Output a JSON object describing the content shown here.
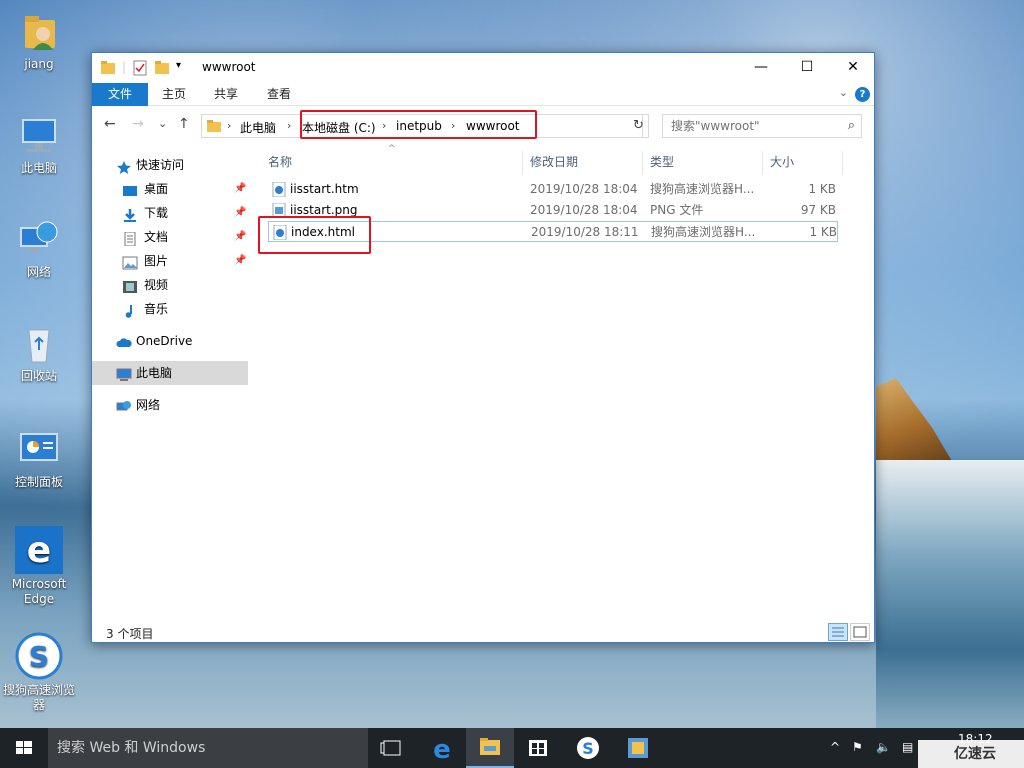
{
  "desktop": {
    "icons": [
      {
        "label": "jiang"
      },
      {
        "label": "此电脑"
      },
      {
        "label": "网络"
      },
      {
        "label": "回收站"
      },
      {
        "label": "控制面板"
      },
      {
        "label": "Microsoft Edge"
      },
      {
        "label": "搜狗高速浏览器"
      }
    ]
  },
  "window": {
    "title": "wwwroot",
    "controls": {
      "minimize": "—",
      "maximize": "☐",
      "close": "✕"
    },
    "ribbon_tabs": {
      "file": "文件",
      "home": "主页",
      "share": "共享",
      "view": "查看"
    },
    "nav_buttons": {
      "back": "←",
      "forward": "→",
      "recent": "⌄",
      "up": "↑"
    },
    "address": {
      "crumbs": [
        "此电脑",
        "本地磁盘 (C:)",
        "inetpub",
        "wwwroot"
      ],
      "separator": "›"
    },
    "search": {
      "placeholder": "搜索\"wwwroot\""
    },
    "nav_pane": [
      {
        "label": "快速访问",
        "pinned": false
      },
      {
        "label": "桌面",
        "pinned": true
      },
      {
        "label": "下载",
        "pinned": true
      },
      {
        "label": "文档",
        "pinned": true
      },
      {
        "label": "图片",
        "pinned": true
      },
      {
        "label": "视频",
        "pinned": false
      },
      {
        "label": "音乐",
        "pinned": false
      },
      {
        "label": "OneDrive",
        "pinned": false
      },
      {
        "label": "此电脑",
        "pinned": false,
        "selected": true
      },
      {
        "label": "网络",
        "pinned": false
      }
    ],
    "columns": {
      "name": "名称",
      "date": "修改日期",
      "type": "类型",
      "size": "大小"
    },
    "files": [
      {
        "name": "iisstart.htm",
        "date": "2019/10/28 18:04",
        "type": "搜狗高速浏览器H...",
        "size": "1 KB"
      },
      {
        "name": "iisstart.png",
        "date": "2019/10/28 18:04",
        "type": "PNG 文件",
        "size": "97 KB"
      },
      {
        "name": "index.html",
        "date": "2019/10/28 18:11",
        "type": "搜狗高速浏览器H...",
        "size": "1 KB",
        "selected": true
      }
    ],
    "status": "3 个项目"
  },
  "taskbar": {
    "search_placeholder": "搜索 Web 和 Windows",
    "clock_time": "18:12",
    "watermark": "亿速云"
  },
  "colors": {
    "accent": "#1979ca",
    "highlight": "#e0141e",
    "taskbar": "#1e2328"
  }
}
